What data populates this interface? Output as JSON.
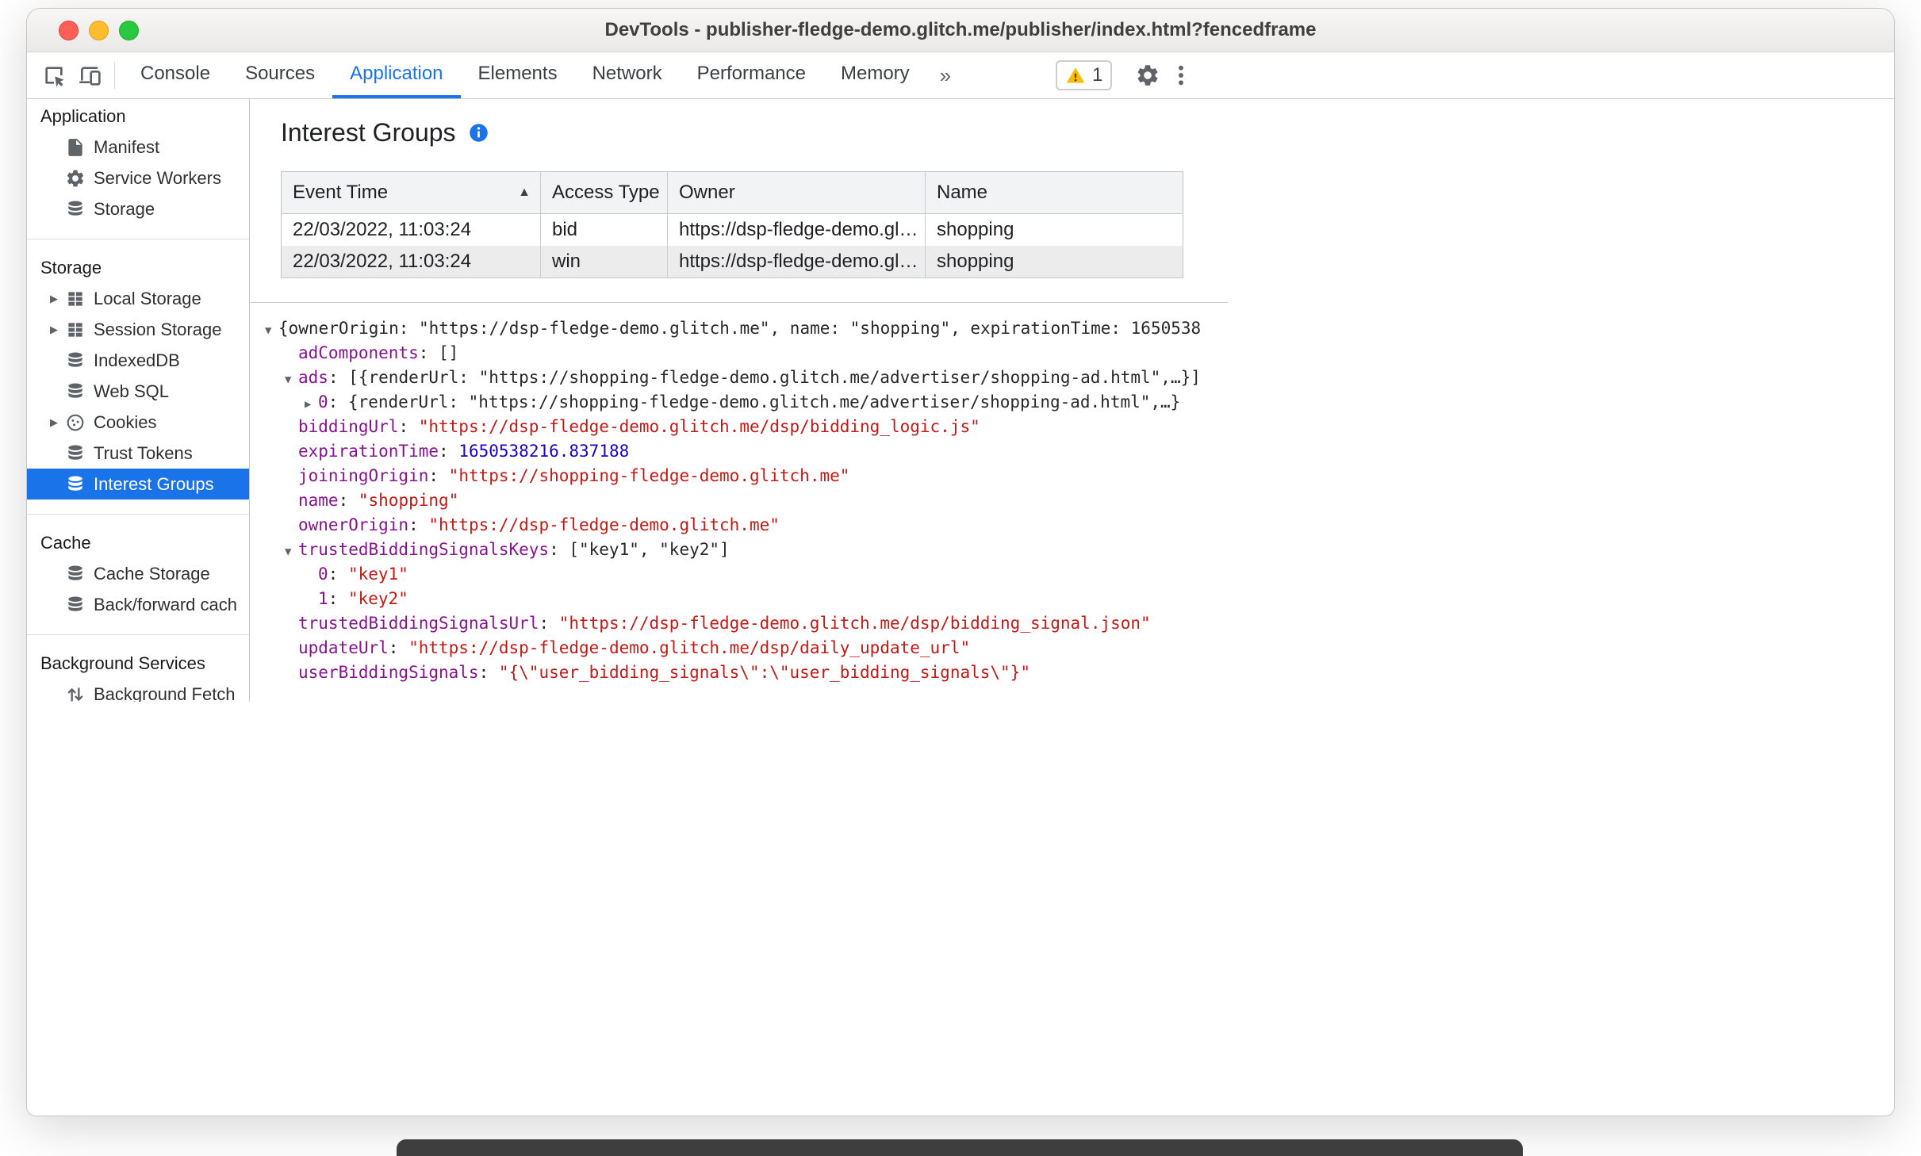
{
  "colors": {
    "accent_blue": "#1a73e8",
    "selected_sidebar_blue": "#1a73e8",
    "json_key_purple": "#881391",
    "json_string_red": "#c41a16",
    "json_number_blue": "#1c00cf",
    "warning_yellow": "#fbbc04"
  },
  "window": {
    "title": "DevTools - publisher-fledge-demo.glitch.me/publisher/index.html?fencedframe"
  },
  "toolbar": {
    "left_icons": [
      {
        "name": "inspect-icon"
      },
      {
        "name": "device-toolbar-icon"
      }
    ],
    "tabs": [
      {
        "label": "Console",
        "active": false
      },
      {
        "label": "Sources",
        "active": false
      },
      {
        "label": "Application",
        "active": true
      },
      {
        "label": "Elements",
        "active": false
      },
      {
        "label": "Network",
        "active": false
      },
      {
        "label": "Performance",
        "active": false
      },
      {
        "label": "Memory",
        "active": false
      }
    ],
    "overflow_chevron": "»",
    "warning_badge": {
      "count": "1"
    },
    "right_icons": [
      {
        "name": "settings-gear-icon"
      },
      {
        "name": "more-options-icon"
      }
    ]
  },
  "sidebar": {
    "sections": [
      {
        "header": "Application",
        "items": [
          {
            "label": "Manifest",
            "icon": "document-icon",
            "expandable": false,
            "selected": false
          },
          {
            "label": "Service Workers",
            "icon": "gear-icon",
            "expandable": false,
            "selected": false
          },
          {
            "label": "Storage",
            "icon": "database-icon",
            "expandable": false,
            "selected": false
          }
        ]
      },
      {
        "header": "Storage",
        "items": [
          {
            "label": "Local Storage",
            "icon": "table-icon",
            "expandable": true,
            "selected": false
          },
          {
            "label": "Session Storage",
            "icon": "table-icon",
            "expandable": true,
            "selected": false
          },
          {
            "label": "IndexedDB",
            "icon": "database-icon",
            "expandable": false,
            "selected": false
          },
          {
            "label": "Web SQL",
            "icon": "database-icon",
            "expandable": false,
            "selected": false
          },
          {
            "label": "Cookies",
            "icon": "cookie-icon",
            "expandable": true,
            "selected": false
          },
          {
            "label": "Trust Tokens",
            "icon": "database-icon",
            "expandable": false,
            "selected": false
          },
          {
            "label": "Interest Groups",
            "icon": "database-icon",
            "expandable": false,
            "selected": true
          }
        ]
      },
      {
        "header": "Cache",
        "items": [
          {
            "label": "Cache Storage",
            "icon": "database-icon",
            "expandable": false,
            "selected": false
          },
          {
            "label": "Back/forward cach",
            "icon": "database-icon",
            "expandable": false,
            "selected": false
          }
        ]
      },
      {
        "header": "Background Services",
        "items": [
          {
            "label": "Background Fetch",
            "icon": "updown-arrows-icon",
            "expandable": false,
            "selected": false
          }
        ]
      }
    ]
  },
  "main": {
    "title": "Interest Groups",
    "table": {
      "columns": [
        {
          "label": "Event Time",
          "sort": "asc"
        },
        {
          "label": "Access Type"
        },
        {
          "label": "Owner"
        },
        {
          "label": "Name"
        }
      ],
      "rows": [
        {
          "cells": [
            "22/03/2022, 11:03:24",
            "bid",
            "https://dsp-fledge-demo.gl…",
            "shopping"
          ],
          "selected": false
        },
        {
          "cells": [
            "22/03/2022, 11:03:24",
            "win",
            "https://dsp-fledge-demo.gl…",
            "shopping"
          ],
          "selected": true
        }
      ]
    },
    "details_tree": {
      "rows": [
        {
          "indent": 0,
          "expander": "open",
          "segments": [
            {
              "text": "{ownerOrigin: \"https://dsp-fledge-demo.glitch.me\", name: \"shopping\", expirationTime: 1650538",
              "color": "plain"
            }
          ]
        },
        {
          "indent": 1,
          "expander": "none",
          "segments": [
            {
              "text": "adComponents",
              "color": "key"
            },
            {
              "text": ": []",
              "color": "plain"
            }
          ]
        },
        {
          "indent": 1,
          "expander": "open",
          "segments": [
            {
              "text": "ads",
              "color": "key"
            },
            {
              "text": ": [{renderUrl: \"https://shopping-fledge-demo.glitch.me/advertiser/shopping-ad.html\",…}]",
              "color": "plain"
            }
          ]
        },
        {
          "indent": 2,
          "expander": "closed",
          "segments": [
            {
              "text": "0",
              "color": "key"
            },
            {
              "text": ": {renderUrl: \"https://shopping-fledge-demo.glitch.me/advertiser/shopping-ad.html\",…}",
              "color": "plain"
            }
          ]
        },
        {
          "indent": 1,
          "expander": "none",
          "segments": [
            {
              "text": "biddingUrl",
              "color": "key"
            },
            {
              "text": ": ",
              "color": "plain"
            },
            {
              "text": "\"https://dsp-fledge-demo.glitch.me/dsp/bidding_logic.js\"",
              "color": "string"
            }
          ]
        },
        {
          "indent": 1,
          "expander": "none",
          "segments": [
            {
              "text": "expirationTime",
              "color": "key"
            },
            {
              "text": ": ",
              "color": "plain"
            },
            {
              "text": "1650538216.837188",
              "color": "number"
            }
          ]
        },
        {
          "indent": 1,
          "expander": "none",
          "segments": [
            {
              "text": "joiningOrigin",
              "color": "key"
            },
            {
              "text": ": ",
              "color": "plain"
            },
            {
              "text": "\"https://shopping-fledge-demo.glitch.me\"",
              "color": "string"
            }
          ]
        },
        {
          "indent": 1,
          "expander": "none",
          "segments": [
            {
              "text": "name",
              "color": "key"
            },
            {
              "text": ": ",
              "color": "plain"
            },
            {
              "text": "\"shopping\"",
              "color": "string"
            }
          ]
        },
        {
          "indent": 1,
          "expander": "none",
          "segments": [
            {
              "text": "ownerOrigin",
              "color": "key"
            },
            {
              "text": ": ",
              "color": "plain"
            },
            {
              "text": "\"https://dsp-fledge-demo.glitch.me\"",
              "color": "string"
            }
          ]
        },
        {
          "indent": 1,
          "expander": "open",
          "segments": [
            {
              "text": "trustedBiddingSignalsKeys",
              "color": "key"
            },
            {
              "text": ": [\"key1\", \"key2\"]",
              "color": "plain"
            }
          ]
        },
        {
          "indent": 2,
          "expander": "none",
          "segments": [
            {
              "text": "0",
              "color": "key"
            },
            {
              "text": ": ",
              "color": "plain"
            },
            {
              "text": "\"key1\"",
              "color": "string"
            }
          ]
        },
        {
          "indent": 2,
          "expander": "none",
          "segments": [
            {
              "text": "1",
              "color": "key"
            },
            {
              "text": ": ",
              "color": "plain"
            },
            {
              "text": "\"key2\"",
              "color": "string"
            }
          ]
        },
        {
          "indent": 1,
          "expander": "none",
          "segments": [
            {
              "text": "trustedBiddingSignalsUrl",
              "color": "key"
            },
            {
              "text": ": ",
              "color": "plain"
            },
            {
              "text": "\"https://dsp-fledge-demo.glitch.me/dsp/bidding_signal.json\"",
              "color": "string"
            }
          ]
        },
        {
          "indent": 1,
          "expander": "none",
          "segments": [
            {
              "text": "updateUrl",
              "color": "key"
            },
            {
              "text": ": ",
              "color": "plain"
            },
            {
              "text": "\"https://dsp-fledge-demo.glitch.me/dsp/daily_update_url\"",
              "color": "string"
            }
          ]
        },
        {
          "indent": 1,
          "expander": "none",
          "segments": [
            {
              "text": "userBiddingSignals",
              "color": "key"
            },
            {
              "text": ": ",
              "color": "plain"
            },
            {
              "text": "\"{\\\"user_bidding_signals\\\":\\\"user_bidding_signals\\\"}\"",
              "color": "string"
            }
          ]
        }
      ]
    }
  }
}
